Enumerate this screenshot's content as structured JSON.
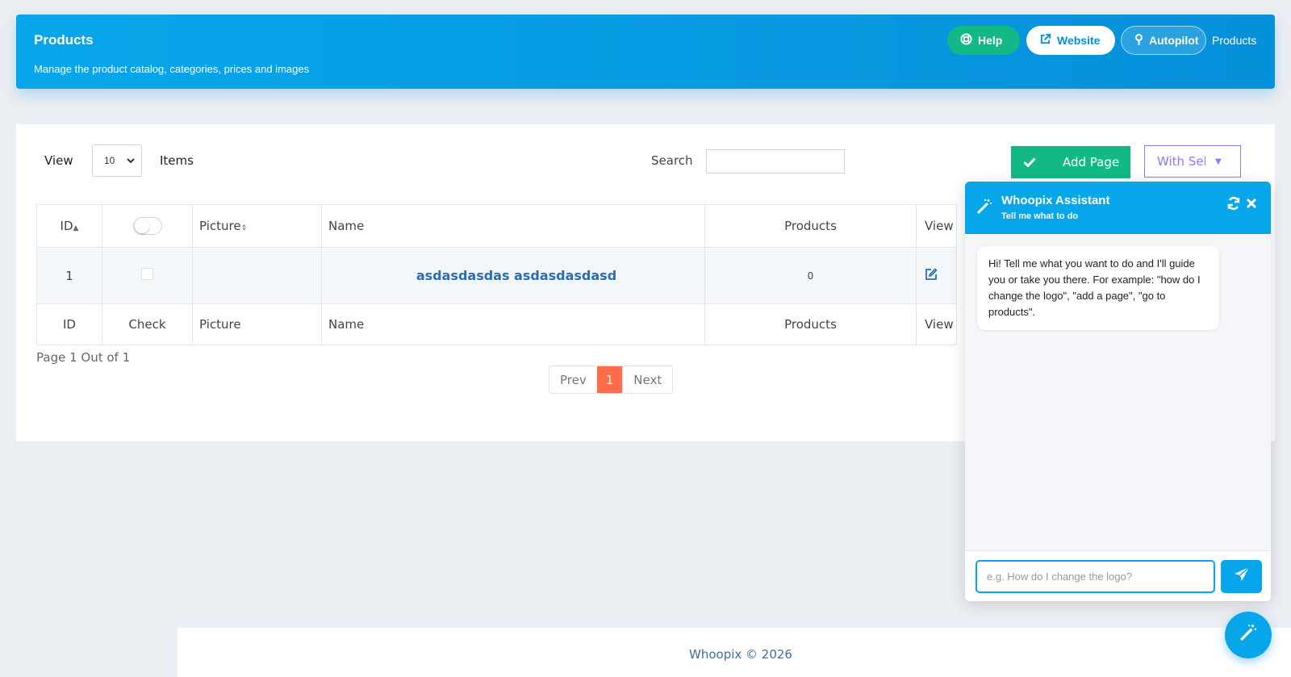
{
  "header": {
    "title": "Products",
    "subtitle": "Manage the product catalog, categories, prices and images",
    "help_label": "Help",
    "website_label": "Website",
    "autopilot_label": "Autopilot",
    "breadcrumb": "Products"
  },
  "toolbar": {
    "view_label": "View",
    "view_value": "10",
    "items_label": "Items",
    "search_label": "Search",
    "search_value": "",
    "add_page_label": "Add Page",
    "with_selected_label": "With Sel"
  },
  "table": {
    "headers": [
      "ID",
      "",
      "Picture",
      "Name",
      "Products",
      "View"
    ],
    "footers": [
      "ID",
      "Check",
      "Picture",
      "Name",
      "Products",
      "View"
    ],
    "rows": [
      {
        "id": "1",
        "picture": "",
        "name": "asdasdasdas asdasdasdasd",
        "products": "0"
      }
    ]
  },
  "pagination": {
    "page_info": "Page 1 Out of 1",
    "prev": "Prev",
    "current": "1",
    "next": "Next"
  },
  "assistant": {
    "title": "Whoopix Assistant",
    "subtitle": "Tell me what to do",
    "message": "Hi! Tell me what you want to do and I'll guide you or take you there. For example: \"how do I change the logo\", \"add a page\", \"go to products\".",
    "input_placeholder": "e.g. How do I change the logo?"
  },
  "footer": {
    "text": "Whoopix © 2026"
  },
  "colors": {
    "accent": "#07a6ea",
    "success": "#12b886",
    "pager_active": "#ff6e4a",
    "link": "#2a6db3"
  }
}
